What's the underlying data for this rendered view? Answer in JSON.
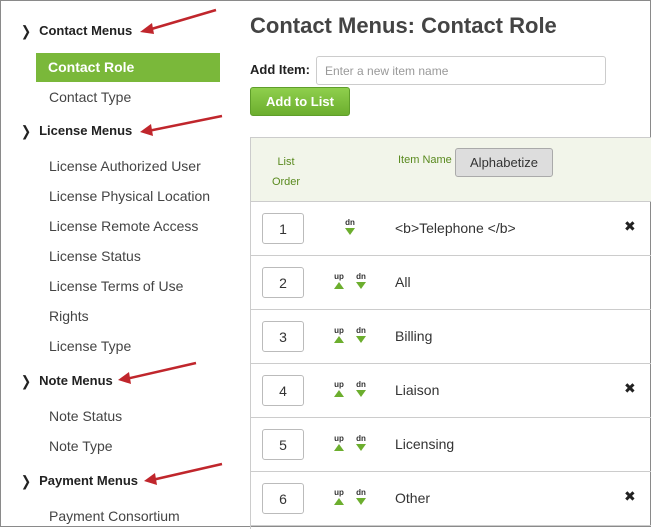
{
  "sidebar": {
    "groups": [
      {
        "label": "Contact Menus",
        "items": [
          "Contact Role",
          "Contact Type"
        ]
      },
      {
        "label": "License Menus",
        "items": [
          "License Authorized User",
          "License Physical Location",
          "License Remote Access",
          "License Status",
          "License Terms of Use",
          "Rights",
          "License Type"
        ]
      },
      {
        "label": "Note Menus",
        "items": [
          "Note Status",
          "Note Type"
        ]
      },
      {
        "label": "Payment Menus",
        "items": [
          "Payment Consortium"
        ]
      }
    ],
    "active_item": "Contact Role"
  },
  "main": {
    "title": "Contact Menus: Contact Role",
    "add_item_label": "Add Item:",
    "add_item_placeholder": "Enter a new item name",
    "add_button": "Add to List",
    "table": {
      "header_order_line1": "List",
      "header_order_line2": "Order",
      "header_name": "Item Name",
      "alphabetize_button": "Alphabetize",
      "up_label": "up",
      "dn_label": "dn",
      "rows": [
        {
          "order": "1",
          "name": "<b>Telephone </b>",
          "up": false,
          "dn": true,
          "deletable": true
        },
        {
          "order": "2",
          "name": "All",
          "up": true,
          "dn": true,
          "deletable": false
        },
        {
          "order": "3",
          "name": "Billing",
          "up": true,
          "dn": true,
          "deletable": false
        },
        {
          "order": "4",
          "name": "Liaison",
          "up": true,
          "dn": true,
          "deletable": true
        },
        {
          "order": "5",
          "name": "Licensing",
          "up": true,
          "dn": true,
          "deletable": false
        },
        {
          "order": "6",
          "name": "Other",
          "up": true,
          "dn": true,
          "deletable": true
        }
      ]
    }
  },
  "colors": {
    "accent": "#7ab83a",
    "arrow": "#c0262c",
    "header_bg": "#f2f5ea"
  }
}
